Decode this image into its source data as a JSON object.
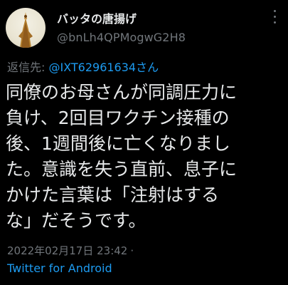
{
  "tweet": {
    "display_name": "バッタの唐揚げ",
    "handle": "@bnLh4QPMogwG2H8",
    "more_icon": "more-vertical-icon",
    "reply": {
      "prefix": "返信先: ",
      "mention": "@IXT62961634さん"
    },
    "body_lines": [
      "同僚のお母さんが同調圧力に",
      "負け、2回目ワクチン接種の",
      "後、1週間後に亡くなりまし",
      "た。意識を失う直前、息子に",
      "かけた言葉は「注射はする",
      "な」だそうです。"
    ],
    "timestamp": "2022年02月17日 23:42",
    "separator": "·",
    "source": "Twitter for Android"
  },
  "colors": {
    "background": "#000000",
    "primary_text": "#e7e9ea",
    "secondary_text": "#71767b",
    "accent": "#1d9bf0"
  }
}
